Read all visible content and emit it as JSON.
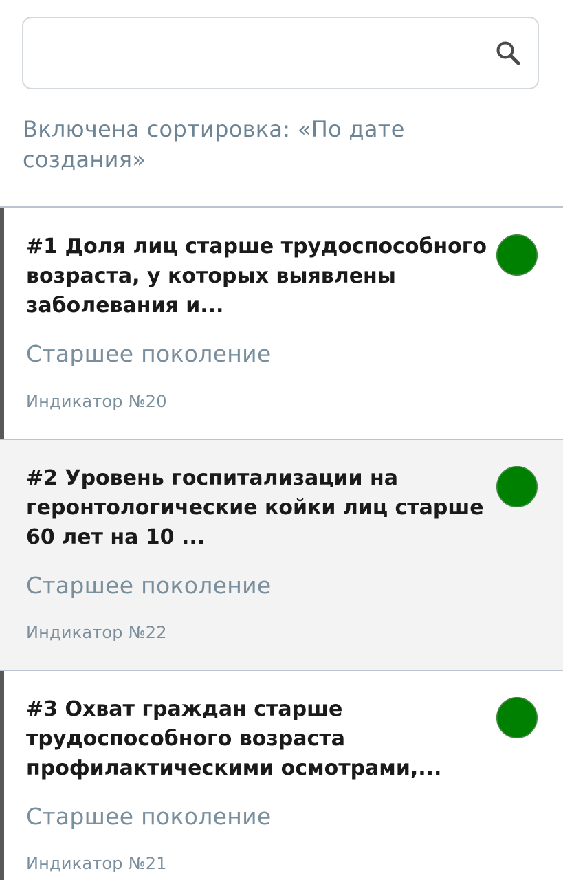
{
  "search": {
    "value": "",
    "placeholder": ""
  },
  "icons": {
    "search": "search-icon"
  },
  "sort_label": "Включена сортировка:  «По дате создания»",
  "colors": {
    "status_green": "#008000",
    "muted_text": "#6d8494",
    "left_bar": "#58585a",
    "selected_bg": "#f3f3f3"
  },
  "items": [
    {
      "title": "#1 Доля лиц старше трудоспособного возраста, у которых выявлены заболевания и...",
      "category": "Старшее поколение",
      "indicator": "Индикатор №20",
      "status_color": "#008000"
    },
    {
      "title": "#2 Уровень госпитализации на геронтологические койки лиц старше 60 лет на 10 ...",
      "category": "Старшее поколение",
      "indicator": "Индикатор №22",
      "status_color": "#008000"
    },
    {
      "title": "#3 Охват граждан старше трудоспособного возраста профилактическими осмотрами,...",
      "category": "Старшее поколение",
      "indicator": "Индикатор №21",
      "status_color": "#008000"
    }
  ]
}
